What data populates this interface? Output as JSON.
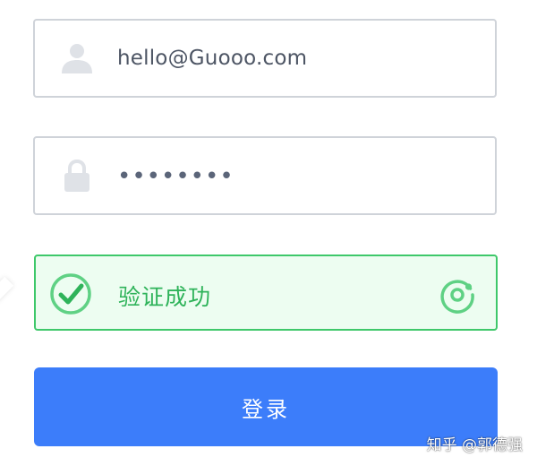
{
  "email_field": {
    "icon": "user-icon",
    "value": "hello@Guooo.com"
  },
  "password_field": {
    "icon": "lock-icon",
    "value": "••••••••"
  },
  "verification": {
    "status_icon": "check-circle-icon",
    "text": "验证成功",
    "refresh_icon": "refresh-icon"
  },
  "login_button": {
    "label": "登录"
  },
  "watermark": {
    "text": "知乎 @郭德强"
  },
  "colors": {
    "field_border": "#cfd3d9",
    "icon_gray": "#dfe2e7",
    "success_green": "#2fb35a",
    "success_bg": "#edfdf1",
    "primary_blue": "#3c7dfa"
  }
}
